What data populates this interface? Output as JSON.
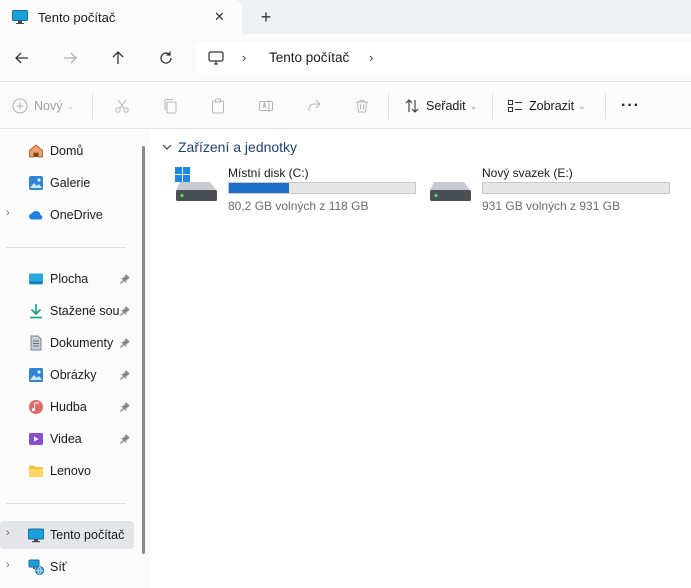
{
  "window": {
    "tab_title": "Tento počítač",
    "tab_close_glyph": "✕",
    "new_tab_glyph": "+"
  },
  "address": {
    "separator": "›",
    "crumbs": [
      "Tento počítač"
    ]
  },
  "toolbar": {
    "new_label": "Nový",
    "sort_label": "Seřadit",
    "view_label": "Zobrazit",
    "more_glyph": "···"
  },
  "sidebar": {
    "expander_glyph": "›",
    "items": [
      {
        "label": "Domů",
        "icon": "home-icon"
      },
      {
        "label": "Galerie",
        "icon": "gallery-icon"
      },
      {
        "label": "OneDrive",
        "icon": "onedrive-icon",
        "expandable": true
      },
      {
        "label": "Plocha",
        "icon": "desktop-icon",
        "pinned": true
      },
      {
        "label": "Stažené soubory",
        "icon": "downloads-icon",
        "pinned": true
      },
      {
        "label": "Dokumenty",
        "icon": "documents-icon",
        "pinned": true
      },
      {
        "label": "Obrázky",
        "icon": "pictures-icon",
        "pinned": true
      },
      {
        "label": "Hudba",
        "icon": "music-icon",
        "pinned": true
      },
      {
        "label": "Videa",
        "icon": "videos-icon",
        "pinned": true
      },
      {
        "label": "Lenovo",
        "icon": "folder-icon"
      },
      {
        "label": "Tento počítač",
        "icon": "this-pc-icon",
        "expandable": true,
        "selected": true
      },
      {
        "label": "Síť",
        "icon": "network-icon",
        "expandable": true
      }
    ]
  },
  "main": {
    "group_title": "Zařízení a jednotky",
    "drives": [
      {
        "name": "Místní disk (C:)",
        "free_text": "80,2 GB volných z 118 GB",
        "used_fraction": 0.32,
        "system": true
      },
      {
        "name": "Nový svazek (E:)",
        "free_text": "931 GB volných z 931 GB",
        "used_fraction": 0.0,
        "system": false
      }
    ]
  },
  "colors": {
    "accent": "#1d6fc9",
    "group_title": "#1f3f72",
    "selected_bg": "#e3e5e8"
  }
}
